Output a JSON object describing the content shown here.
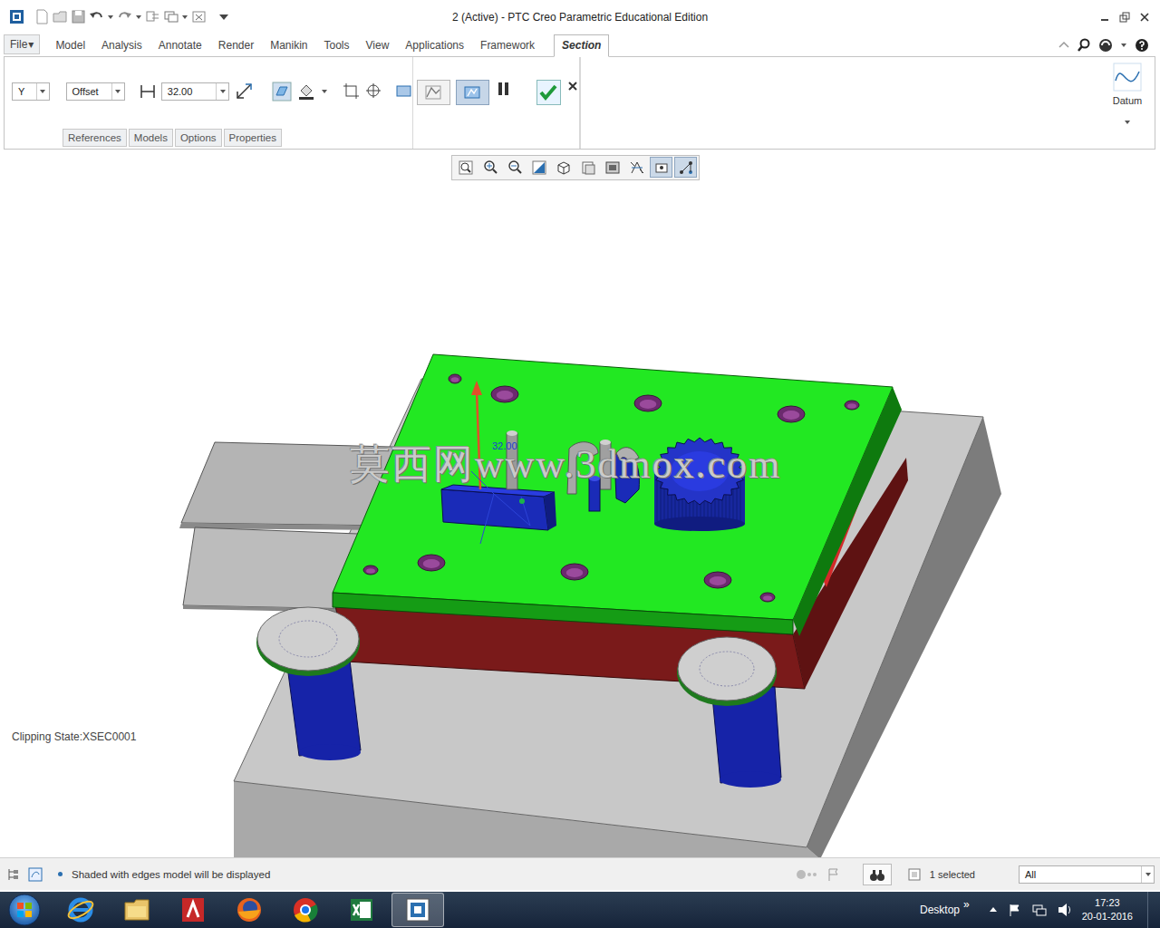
{
  "window": {
    "title": "2 (Active) - PTC Creo Parametric Educational Edition"
  },
  "tabs": [
    {
      "label": "File",
      "caret": "▾",
      "kind": "menu",
      "selected": false
    },
    {
      "label": "Model",
      "kind": "tab",
      "selected": false
    },
    {
      "label": "Analysis",
      "kind": "tab",
      "selected": false
    },
    {
      "label": "Annotate",
      "kind": "tab",
      "selected": false
    },
    {
      "label": "Render",
      "kind": "tab",
      "selected": false
    },
    {
      "label": "Manikin",
      "kind": "tab",
      "selected": false
    },
    {
      "label": "Tools",
      "kind": "tab",
      "selected": false
    },
    {
      "label": "View",
      "kind": "tab",
      "selected": false
    },
    {
      "label": "Applications",
      "kind": "tab",
      "selected": false
    },
    {
      "label": "Framework",
      "kind": "tab",
      "selected": false
    },
    {
      "label": "Section",
      "kind": "tab",
      "selected": true
    }
  ],
  "ribbon": {
    "reference_plane": "Y",
    "type": "Offset",
    "offset": "32.00",
    "preview_buttons": [
      {
        "selected": false
      },
      {
        "selected": true
      }
    ],
    "subtabs": [
      {
        "label": "References"
      },
      {
        "label": "Models"
      },
      {
        "label": "Options"
      },
      {
        "label": "Properties"
      }
    ],
    "datum": "Datum"
  },
  "graphics_toolbar": [
    {
      "kind": "refit",
      "selected": false
    },
    {
      "kind": "zoomin",
      "selected": false
    },
    {
      "kind": "zoomout",
      "selected": false
    },
    {
      "kind": "repaint",
      "selected": false
    },
    {
      "kind": "orient",
      "selected": false
    },
    {
      "kind": "saved",
      "selected": false
    },
    {
      "kind": "display",
      "selected": false
    },
    {
      "kind": "datum",
      "selected": false
    },
    {
      "kind": "spin",
      "selected": true
    },
    {
      "kind": "annot",
      "selected": true
    }
  ],
  "viewport": {
    "watermark": "莫西网www.3dmox.com",
    "dimension": "32.00",
    "clipping_state": "Clipping State:XSEC0001"
  },
  "status_bar": {
    "message": "Shaded with edges model will be displayed",
    "selection": "1 selected",
    "filter": "All"
  },
  "taskbar": {
    "apps": [
      {
        "kind": "ie",
        "selected": false
      },
      {
        "kind": "explorer",
        "selected": false
      },
      {
        "kind": "autocad",
        "selected": false
      },
      {
        "kind": "firefox",
        "selected": false
      },
      {
        "kind": "chrome",
        "selected": false
      },
      {
        "kind": "excel",
        "selected": false
      },
      {
        "kind": "creo",
        "selected": true
      }
    ],
    "desktop": "Desktop",
    "chevron": "»",
    "time": "17:23",
    "date": "20-01-2016"
  }
}
